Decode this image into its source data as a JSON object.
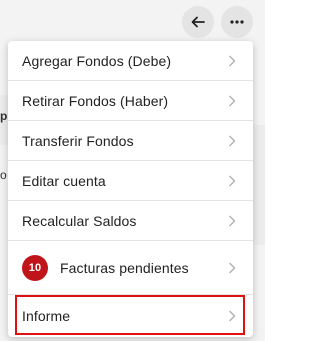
{
  "topbar": {
    "back_icon": "arrow-left-icon",
    "more_icon": "more-horizontal-icon"
  },
  "background": {
    "peek_text_1": "p",
    "peek_text_2": "o"
  },
  "menu": {
    "items": [
      {
        "label": "Agregar Fondos (Debe)"
      },
      {
        "label": "Retirar Fondos (Haber)"
      },
      {
        "label": "Transferir Fondos"
      },
      {
        "label": "Editar cuenta"
      },
      {
        "label": "Recalcular Saldos"
      },
      {
        "label": "Facturas pendientes",
        "badge": "10"
      },
      {
        "label": "Informe"
      }
    ]
  },
  "colors": {
    "badge": "#c0141b",
    "highlight_border": "#e01010",
    "chevron": "#b5b5b5"
  }
}
